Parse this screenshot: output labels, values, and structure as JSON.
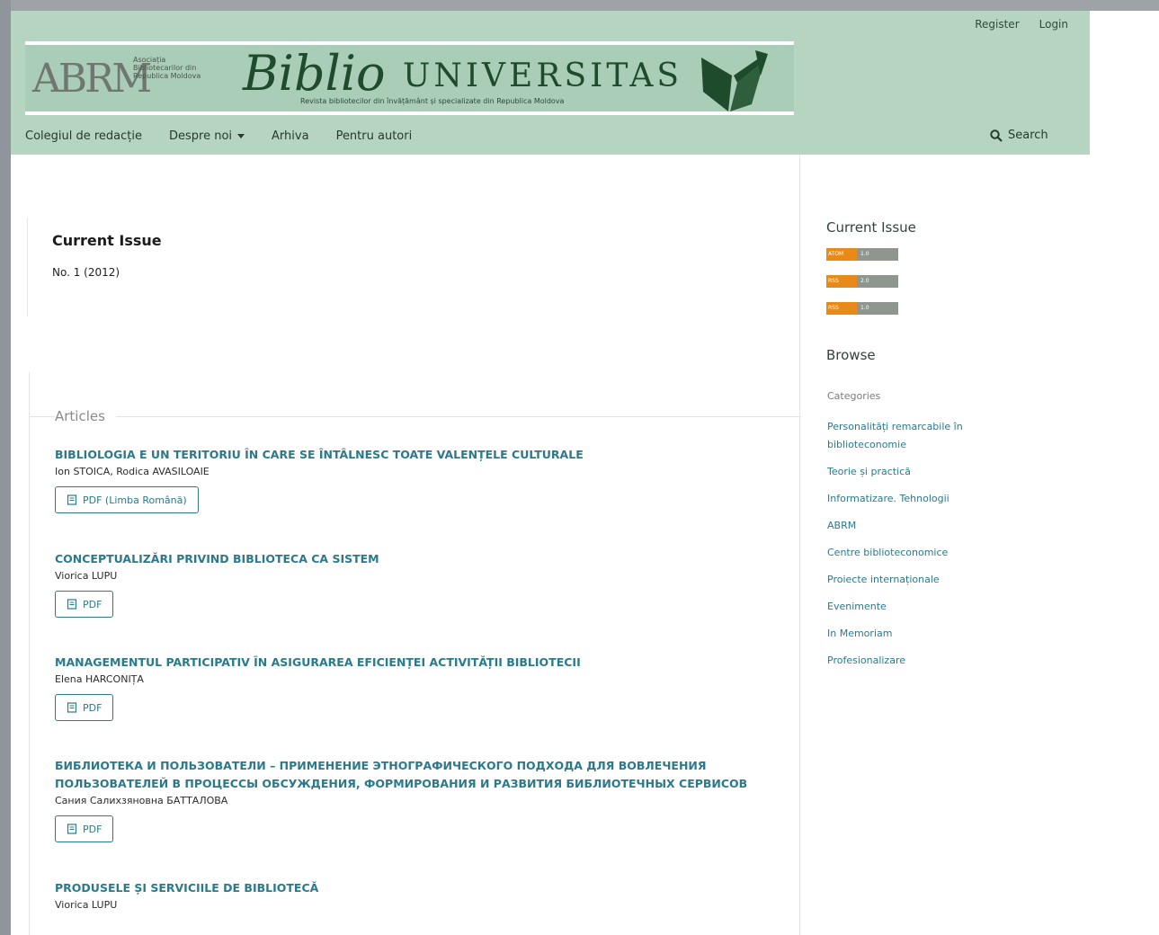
{
  "header": {
    "user_nav": {
      "register": "Register",
      "login": "Login"
    },
    "logo": {
      "abrm": "ABRM",
      "association": "Asociația Bibliotecarilor din Republica Moldova",
      "biblio": "Biblio",
      "universitas": "UNIVERSITAS",
      "subtitle": "Revista bibliotecilor din învățământ și specializate din Republica Moldova"
    },
    "nav": [
      {
        "label": "Colegiul de redacție"
      },
      {
        "label": "Despre noi"
      },
      {
        "label": "Arhiva"
      },
      {
        "label": "Pentru autori"
      }
    ],
    "search_label": "Search"
  },
  "main": {
    "title": "Current Issue",
    "issue": "No. 1 (2012)",
    "articles_heading": "Articles",
    "articles": [
      {
        "title": "BIBLIOLOGIA E UN TERITORIU ÎN CARE SE ÎNTÂLNESC TOATE VALENȚELE CULTURALE",
        "authors": "Ion STOICA, Rodica AVASILOAIE",
        "galley": "PDF (Limba Română)"
      },
      {
        "title": "CONCEPTUALIZĂRI PRIVIND BIBLIOTECA CA SISTEM",
        "authors": "Viorica LUPU",
        "galley": "PDF"
      },
      {
        "title": "MANAGEMENTUL PARTICIPATIV ÎN ASIGURAREA EFICIENȚEI ACTIVITĂȚII BIBLIOTECII",
        "authors": "Elena HARCONIȚA",
        "galley": "PDF"
      },
      {
        "title": "БИБЛИОТЕКА И ПОЛЬЗОВАТЕЛИ – ПРИМЕНЕНИЕ ЭТНОГРАФИЧЕСКОГО ПОДХОДА ДЛЯ ВОВЛЕЧЕНИЯ ПОЛЬЗОВАТЕЛЕЙ В ПРОЦЕССЫ ОБСУЖДЕНИЯ, ФОРМИРОВАНИЯ И РАЗВИТИЯ БИБЛИОТЕЧНЫХ СЕРВИСОВ",
        "authors": "Сания Салихзяновна БАТТАЛОВА",
        "galley": "PDF"
      },
      {
        "title": "PRODUSELE ȘI SERVICIILE DE BIBLIOTECĂ",
        "authors": "Viorica LUPU"
      }
    ]
  },
  "sidebar": {
    "current_issue_title": "Current Issue",
    "feeds": [
      {
        "left": "ATOM",
        "right": "1.0"
      },
      {
        "left": "RSS",
        "right": "2.0"
      },
      {
        "left": "RSS",
        "right": "1.0"
      }
    ],
    "browse_title": "Browse",
    "browse_items": [
      "Categories",
      "Personalități remarcabile în biblioteconomie",
      "Teorie și practică",
      "Informatizare. Tehnologii",
      "ABRM",
      "Centre biblioteconomice",
      "Proiecte internaționale",
      "Evenimente",
      "In Memoriam",
      "Profesionalizare"
    ]
  },
  "colors": {
    "header_bg": "#b5d5c1",
    "link": "#2a7a8c",
    "feed_orange": "#e88a1a"
  }
}
